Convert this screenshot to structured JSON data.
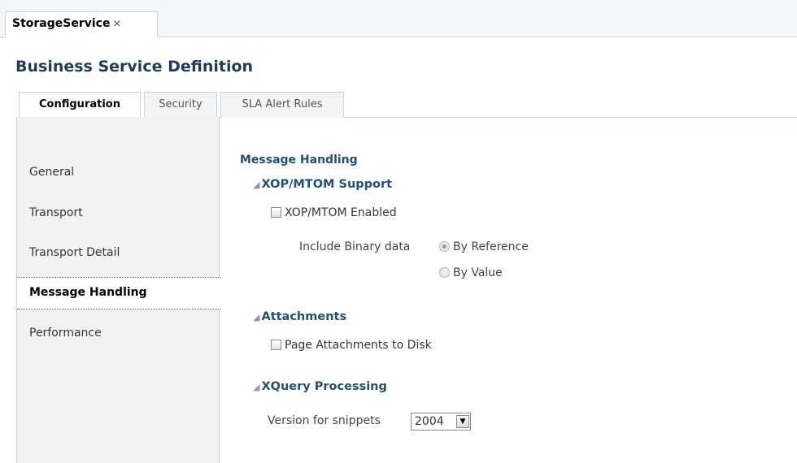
{
  "document_tab": {
    "title": "StorageService",
    "close_glyph": "×"
  },
  "page": {
    "title": "Business Service Definition"
  },
  "tabs": [
    {
      "label": "Configuration",
      "active": true
    },
    {
      "label": "Security",
      "active": false
    },
    {
      "label": "SLA Alert Rules",
      "active": false
    }
  ],
  "sidebar": {
    "items": [
      {
        "label": "General",
        "active": false
      },
      {
        "label": "Transport",
        "active": false
      },
      {
        "label": "Transport Detail",
        "active": false
      },
      {
        "label": "Message Handling",
        "active": true
      },
      {
        "label": "Performance",
        "active": false
      }
    ]
  },
  "content": {
    "section_title": "Message Handling",
    "xop": {
      "title": "XOP/MTOM Support",
      "enabled_label": "XOP/MTOM Enabled",
      "enabled_checked": false,
      "binary_label": "Include Binary data",
      "by_reference_label": "By Reference",
      "by_value_label": "By Value",
      "selected": "By Reference"
    },
    "attachments": {
      "title": "Attachments",
      "page_to_disk_label": "Page Attachments to Disk",
      "page_to_disk_checked": false
    },
    "xquery": {
      "title": "XQuery Processing",
      "version_label": "Version for snippets",
      "version_value": "2004"
    }
  },
  "colors": {
    "title": "#1f3a5f",
    "section": "#1f4f7a",
    "border": "#c8d2dc",
    "sidebar_bg": "#f2f2f2"
  }
}
